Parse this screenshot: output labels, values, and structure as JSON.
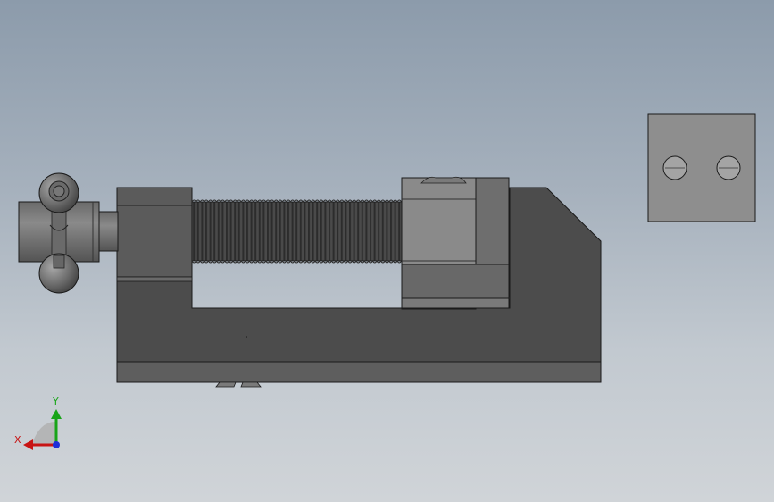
{
  "triad": {
    "x_label": "X",
    "y_label": "Y",
    "colors": {
      "x": "#c81414",
      "y": "#18a418",
      "z": "#1e2ed8"
    }
  },
  "model": {
    "colors": {
      "background_top": "#8c9bab",
      "background_bottom": "#d0d4d8",
      "dark_body": "#4c4c4c",
      "mid_body": "#5e5e5e",
      "light_part": "#8a8a8a",
      "jaw_plate": "#8e8e8e",
      "thread": "#3c3c3c",
      "edge": "#1a1a1a"
    }
  }
}
